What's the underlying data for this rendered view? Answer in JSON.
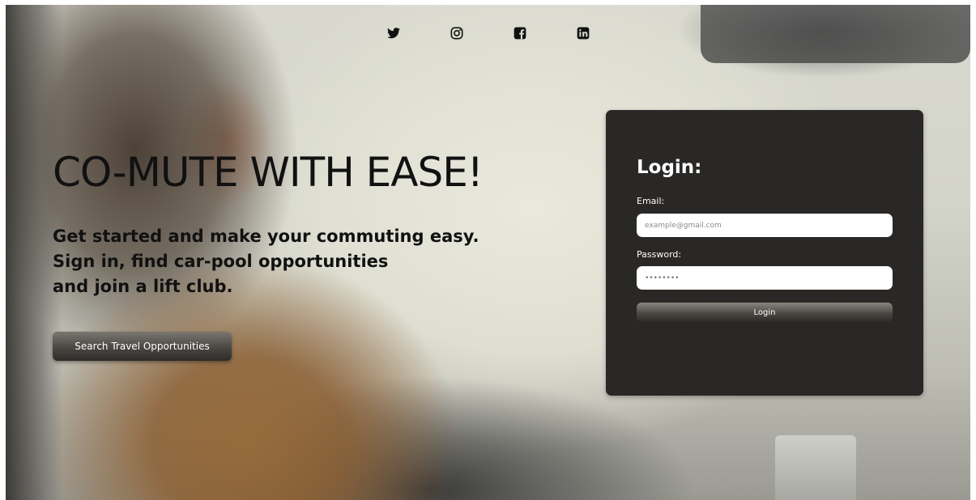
{
  "social": {
    "items": [
      {
        "icon": "twitter-icon"
      },
      {
        "icon": "instagram-icon"
      },
      {
        "icon": "facebook-icon"
      },
      {
        "icon": "linkedin-icon"
      }
    ]
  },
  "hero": {
    "title": "CO-MUTE WITH EASE!",
    "lines": [
      "Get started and make your commuting easy.",
      "Sign in, find car-pool opportunities",
      "and join a lift club."
    ],
    "cta_label": "Search Travel Opportunities"
  },
  "login": {
    "title": "Login:",
    "email_label": "Email:",
    "email_placeholder": "example@gmail.com",
    "password_label": "Password:",
    "password_value": "********",
    "submit_label": "Login"
  },
  "colors": {
    "card_background": "#2a2826",
    "text_dark": "#111111",
    "button_gradient_top": "#7a7670",
    "button_gradient_bottom": "#2e2c29"
  }
}
